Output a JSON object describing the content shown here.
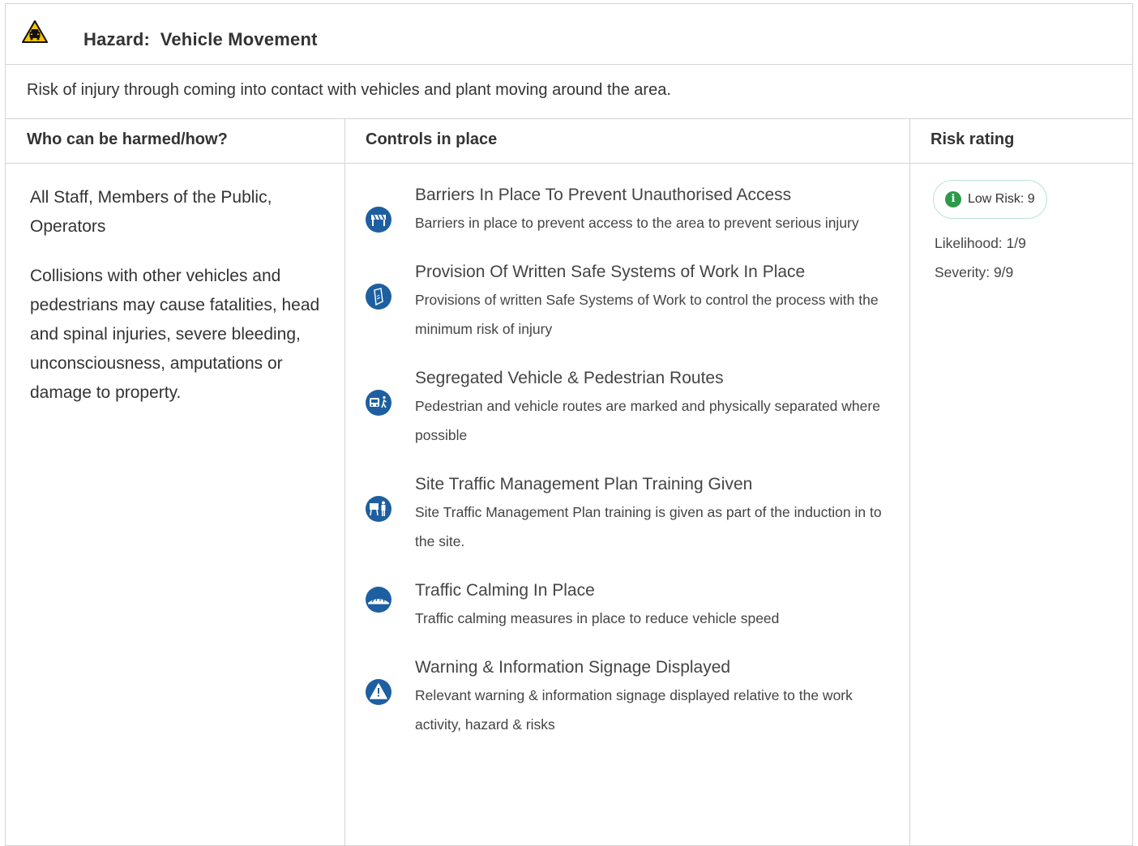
{
  "hazard": {
    "title": "Hazard:  Vehicle Movement",
    "description": "Risk of injury through coming into contact with vehicles and plant moving around the area.",
    "icon": "warning-vehicle-icon"
  },
  "columns": {
    "who": "Who can be harmed/how?",
    "controls": "Controls in place",
    "risk": "Risk rating"
  },
  "who": {
    "people": "All Staff, Members of the Public, Operators",
    "harm": "Collisions with other vehicles and pedestrians may cause fatalities, head and spinal injuries, severe bleeding, unconsciousness, amputations or damage to property."
  },
  "controls": [
    {
      "title": "Barriers In Place To Prevent Unauthorised Access",
      "description": "Barriers in place to prevent access to the area to prevent serious injury",
      "icon": "barrier-icon"
    },
    {
      "title": "Provision Of Written Safe Systems of Work In Place",
      "description": "Provisions of written Safe Systems of Work to control the process with the minimum risk of injury",
      "icon": "document-icon"
    },
    {
      "title": "Segregated Vehicle & Pedestrian Routes",
      "description": "Pedestrian and vehicle routes are marked and physically separated where possible",
      "icon": "vehicle-pedestrian-icon"
    },
    {
      "title": "Site Traffic Management Plan Training Given",
      "description": "Site Traffic Management Plan training is given as part of the induction in to the site.",
      "icon": "training-icon"
    },
    {
      "title": "Traffic Calming In Place",
      "description": "Traffic calming measures in place to reduce vehicle speed",
      "icon": "speed-bump-icon"
    },
    {
      "title": "Warning & Information Signage Displayed",
      "description": "Relevant warning & information signage displayed relative to the work activity, hazard & risks",
      "icon": "warning-sign-icon"
    }
  ],
  "risk": {
    "badge": "Low Risk: 9",
    "badge_color": "#2c9a4a",
    "likelihood": "Likelihood: 1/9",
    "severity": "Severity: 9/9"
  },
  "colors": {
    "icon_blue": "#1d5fa0",
    "hazard_yellow": "#f5c400",
    "border": "#d4d4d4"
  }
}
